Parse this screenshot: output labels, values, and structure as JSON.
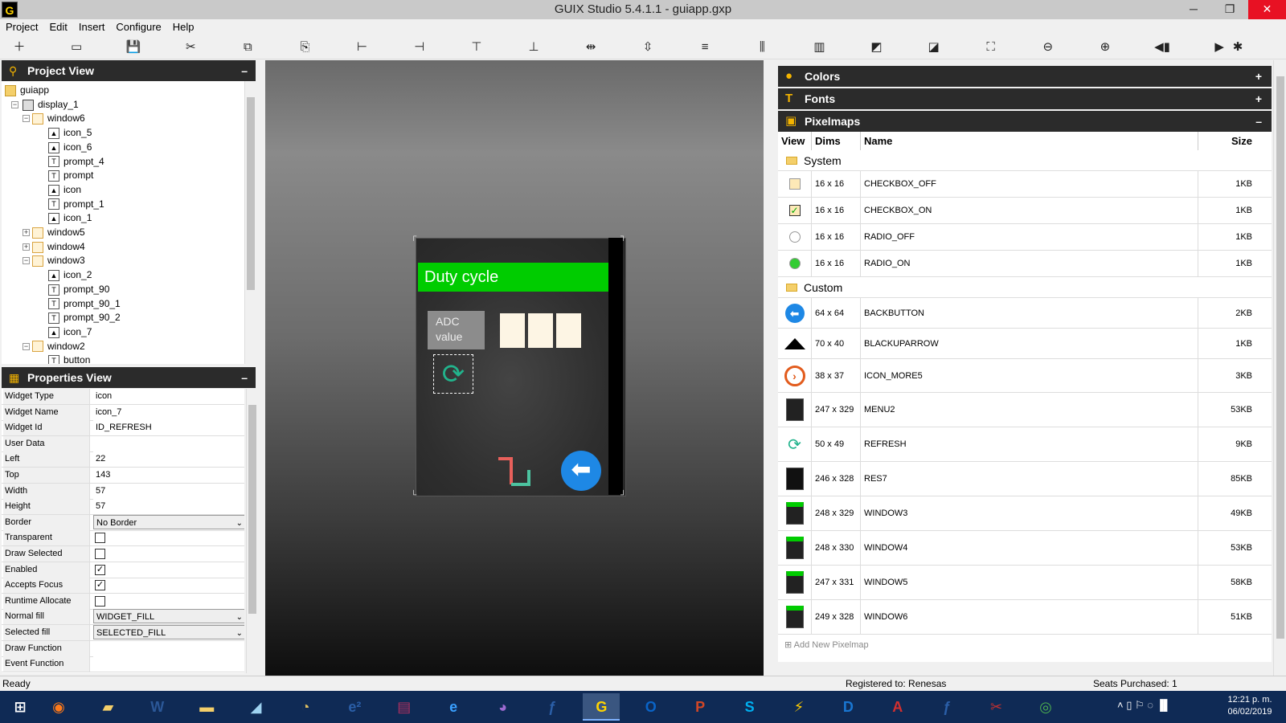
{
  "window": {
    "title": "GUIX Studio 5.4.1.1 - guiapp.gxp",
    "icon_text": "G",
    "minimize": "─",
    "maximize": "❐",
    "close": "✕"
  },
  "menu": [
    "Project",
    "Edit",
    "Insert",
    "Configure",
    "Help"
  ],
  "toolbar_icons": [
    "add-icon",
    "open-folder-icon",
    "save-icon",
    "cut-icon",
    "copy-icon",
    "paste-icon",
    "align-left-icon",
    "align-right-icon",
    "align-top-icon",
    "align-bottom-icon",
    "equal-width-icon",
    "equal-height-icon",
    "vspace-icon",
    "hspace-icon",
    "size-to-content-icon",
    "move-to-front-icon",
    "move-to-back-icon",
    "fit-icon",
    "zoom-out-icon",
    "zoom-in-icon",
    "record-macro-icon",
    "run-icon",
    "playback-icon"
  ],
  "project_view": {
    "title": "Project View",
    "collapse": "–",
    "tree": [
      {
        "label": "guiapp",
        "kind": "folder",
        "level": 0
      },
      {
        "label": "display_1",
        "kind": "disp",
        "level": 1,
        "exp": "−"
      },
      {
        "label": "window6",
        "kind": "win",
        "level": 2,
        "exp": "−"
      },
      {
        "label": "icon_5",
        "kind": "icon",
        "level": 3
      },
      {
        "label": "icon_6",
        "kind": "icon",
        "level": 3
      },
      {
        "label": "prompt_4",
        "kind": "prompt",
        "level": 3
      },
      {
        "label": "prompt",
        "kind": "prompt",
        "level": 3
      },
      {
        "label": "icon",
        "kind": "icon",
        "level": 3
      },
      {
        "label": "prompt_1",
        "kind": "prompt",
        "level": 3
      },
      {
        "label": "icon_1",
        "kind": "icon",
        "level": 3
      },
      {
        "label": "window5",
        "kind": "win",
        "level": 2,
        "exp": "+"
      },
      {
        "label": "window4",
        "kind": "win",
        "level": 2,
        "exp": "+"
      },
      {
        "label": "window3",
        "kind": "win",
        "level": 2,
        "exp": "−"
      },
      {
        "label": "icon_2",
        "kind": "icon",
        "level": 3
      },
      {
        "label": "prompt_90",
        "kind": "prompt",
        "level": 3
      },
      {
        "label": "prompt_90_1",
        "kind": "prompt",
        "level": 3
      },
      {
        "label": "prompt_90_2",
        "kind": "prompt",
        "level": 3
      },
      {
        "label": "icon_7",
        "kind": "icon",
        "level": 3
      },
      {
        "label": "window2",
        "kind": "win",
        "level": 2,
        "exp": "−"
      },
      {
        "label": "button",
        "kind": "prompt",
        "level": 3
      }
    ]
  },
  "properties_view": {
    "title": "Properties View",
    "collapse": "–",
    "rows": [
      {
        "name": "Widget Type",
        "value": "icon",
        "type": "text"
      },
      {
        "name": "Widget Name",
        "value": "icon_7",
        "type": "text"
      },
      {
        "name": "Widget Id",
        "value": "ID_REFRESH",
        "type": "text"
      },
      {
        "name": "User Data",
        "value": "",
        "type": "text"
      },
      {
        "name": "Left",
        "value": "22",
        "type": "text"
      },
      {
        "name": "Top",
        "value": "143",
        "type": "text"
      },
      {
        "name": "Width",
        "value": "57",
        "type": "text"
      },
      {
        "name": "Height",
        "value": "57",
        "type": "text"
      },
      {
        "name": "Border",
        "value": "No Border",
        "type": "select"
      },
      {
        "name": "Transparent",
        "value": "",
        "type": "check",
        "checked": false
      },
      {
        "name": "Draw Selected",
        "value": "",
        "type": "check",
        "checked": false
      },
      {
        "name": "Enabled",
        "value": "",
        "type": "check",
        "checked": true
      },
      {
        "name": "Accepts Focus",
        "value": "",
        "type": "check",
        "checked": true
      },
      {
        "name": "Runtime Allocate",
        "value": "",
        "type": "check",
        "checked": false
      },
      {
        "name": "Normal fill",
        "value": "WIDGET_FILL",
        "type": "select"
      },
      {
        "name": "Selected fill",
        "value": "SELECTED_FILL",
        "type": "select"
      },
      {
        "name": "Draw Function",
        "value": "",
        "type": "text"
      },
      {
        "name": "Event Function",
        "value": "",
        "type": "text"
      }
    ]
  },
  "canvas": {
    "duty_title": "Duty cycle",
    "adc_line1": "ADC",
    "adc_line2": "value",
    "refresh_glyph": "⟳",
    "back_glyph": "⬅",
    "accent_green": "#00cc00",
    "accent_blue": "#1e88e5"
  },
  "resources": {
    "colors": {
      "title": "Colors",
      "toggle": "+"
    },
    "fonts": {
      "title": "Fonts",
      "toggle": "+"
    },
    "pixelmaps": {
      "title": "Pixelmaps",
      "toggle": "–",
      "columns": [
        "View",
        "Dims",
        "Name",
        "Size"
      ],
      "groups": [
        {
          "name": "System",
          "items": [
            {
              "dims": "16 x 16",
              "name": "CHECKBOX_OFF",
              "size": "1KB",
              "thumb": "checkbox-off"
            },
            {
              "dims": "16 x 16",
              "name": "CHECKBOX_ON",
              "size": "1KB",
              "thumb": "checkbox-on"
            },
            {
              "dims": "16 x 16",
              "name": "RADIO_OFF",
              "size": "1KB",
              "thumb": "radio-off"
            },
            {
              "dims": "16 x 16",
              "name": "RADIO_ON",
              "size": "1KB",
              "thumb": "radio-on"
            }
          ]
        },
        {
          "name": "Custom",
          "items": [
            {
              "dims": "64 x 64",
              "name": "BACKBUTTON",
              "size": "2KB",
              "thumb": "back"
            },
            {
              "dims": "70 x 40",
              "name": "BLACKUPARROW",
              "size": "1KB",
              "thumb": "uparrow"
            },
            {
              "dims": "38 x 37",
              "name": "ICON_MORE5",
              "size": "3KB",
              "thumb": "more"
            },
            {
              "dims": "247 x 329",
              "name": "MENU2",
              "size": "53KB",
              "thumb": "screen"
            },
            {
              "dims": "50 x 49",
              "name": "REFRESH",
              "size": "9KB",
              "thumb": "refresh"
            },
            {
              "dims": "246 x 328",
              "name": "RES7",
              "size": "85KB",
              "thumb": "screen-dark"
            },
            {
              "dims": "248 x 329",
              "name": "WINDOW3",
              "size": "49KB",
              "thumb": "screen-green"
            },
            {
              "dims": "248 x 330",
              "name": "WINDOW4",
              "size": "53KB",
              "thumb": "screen-green"
            },
            {
              "dims": "247 x 331",
              "name": "WINDOW5",
              "size": "58KB",
              "thumb": "screen-green"
            },
            {
              "dims": "249 x 328",
              "name": "WINDOW6",
              "size": "51KB",
              "thumb": "screen-green"
            }
          ]
        }
      ],
      "add_new": "Add New Pixelmap"
    }
  },
  "status": {
    "left": "Ready",
    "registered": "Registered to: Renesas",
    "seats": "Seats Purchased: 1"
  },
  "taskbar": {
    "apps": [
      "windows-start-icon",
      "firefox-icon",
      "file-explorer-icon",
      "word-icon",
      "folder-icon",
      "notepad-icon",
      "paint-icon",
      "e2studio-icon",
      "winrar-icon",
      "internet-explorer-icon",
      "cat-app-icon",
      "tlr-icon",
      "guix-icon",
      "outlook-icon",
      "powerpoint-icon",
      "skype-icon",
      "flash-tool-icon",
      "devc-icon",
      "acrobat-icon",
      "tlr2-icon",
      "sniping-icon",
      "chrome-icon"
    ],
    "time": "12:21 p. m.",
    "date": "06/02/2019"
  }
}
